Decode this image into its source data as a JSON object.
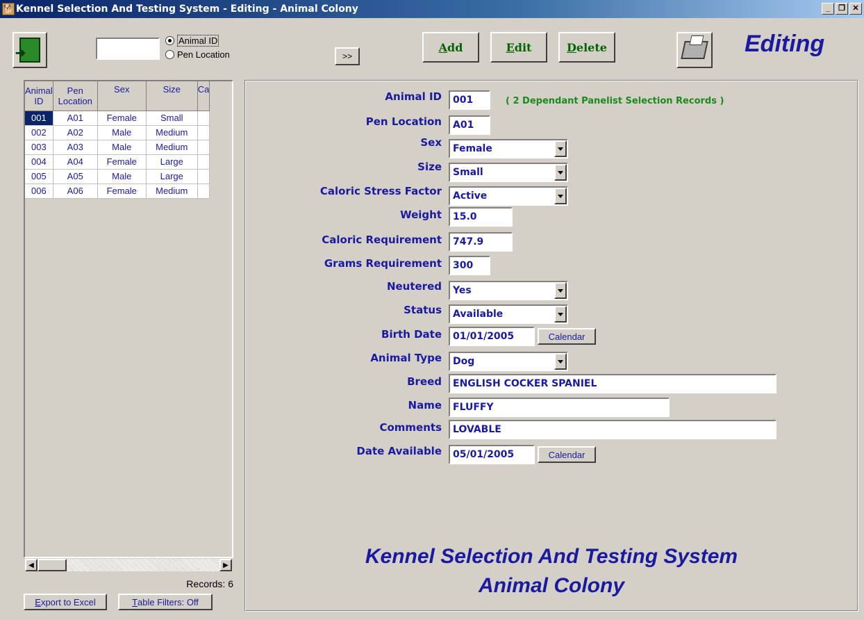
{
  "window": {
    "title": "Kennel Selection And Testing System - Editing - Animal Colony",
    "controls": [
      "_",
      "❐",
      "✕"
    ]
  },
  "toolbar": {
    "search_value": "",
    "radio_animal_id": "Animal ID",
    "radio_pen_location": "Pen Location",
    "go_label": ">>",
    "add_prefix": "",
    "add_ul": "A",
    "add_rest": "dd",
    "edit_ul": "E",
    "edit_rest": "dit",
    "delete_ul": "D",
    "delete_rest": "elete",
    "mode": "Editing"
  },
  "grid": {
    "columns": [
      "Animal ID",
      "Pen Location",
      "Sex",
      "Size",
      "Ca"
    ],
    "rows": [
      [
        "001",
        "A01",
        "Female",
        "Small"
      ],
      [
        "002",
        "A02",
        "Male",
        "Medium"
      ],
      [
        "003",
        "A03",
        "Male",
        "Medium"
      ],
      [
        "004",
        "A04",
        "Female",
        "Large"
      ],
      [
        "005",
        "A05",
        "Male",
        "Large"
      ],
      [
        "006",
        "A06",
        "Female",
        "Medium"
      ]
    ],
    "records": "Records: 6",
    "export_ul": "E",
    "export_rest": "xport to Excel",
    "filters_ul": "T",
    "filters_rest": "able Filters: Off"
  },
  "form": {
    "animal_id_label": "Animal ID",
    "animal_id": "001",
    "dependants_note": "( 2 Dependant Panelist Selection Records )",
    "pen_location_label": "Pen Location",
    "pen_location": "A01",
    "sex_label": "Sex",
    "sex": "Female",
    "size_label": "Size",
    "size": "Small",
    "stress_label": "Caloric Stress Factor",
    "stress": "Active",
    "weight_label": "Weight",
    "weight": "15.0",
    "caloric_req_label": "Caloric Requirement",
    "caloric_req": "747.9",
    "grams_req_label": "Grams Requirement",
    "grams_req": "300",
    "neutered_label": "Neutered",
    "neutered": "Yes",
    "status_label": "Status",
    "status": "Available",
    "birth_date_label": "Birth Date",
    "birth_date": "01/01/2005",
    "calendar_label": "Calendar",
    "animal_type_label": "Animal Type",
    "animal_type": "Dog",
    "breed_label": "Breed",
    "breed": "ENGLISH COCKER SPANIEL",
    "name_label": "Name",
    "name": "FLUFFY",
    "comments_label": "Comments",
    "comments": "LOVABLE",
    "date_available_label": "Date Available",
    "date_available": "05/01/2005"
  },
  "footer": {
    "line1": "Kennel Selection And Testing System",
    "line2": "Animal Colony"
  }
}
